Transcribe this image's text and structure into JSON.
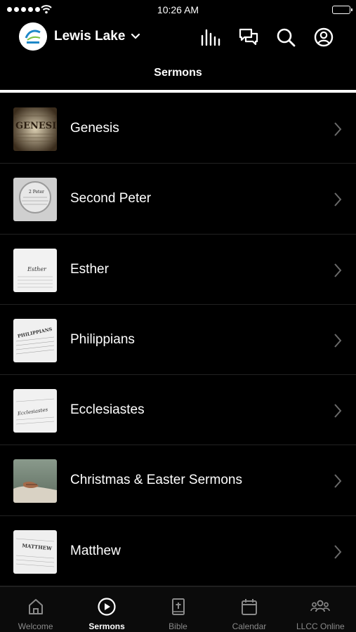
{
  "status_bar": {
    "time": "10:26 AM"
  },
  "header": {
    "org_name": "Lewis Lake",
    "logo_text": "Lewis Lake"
  },
  "tab": {
    "title": "Sermons"
  },
  "sermons": [
    {
      "title": "Genesis",
      "thumb": "GENESIS"
    },
    {
      "title": "Second Peter",
      "thumb": "2 Peter"
    },
    {
      "title": "Esther",
      "thumb": "Esther"
    },
    {
      "title": "Philippians",
      "thumb": "PHILIPPIANS"
    },
    {
      "title": "Ecclesiastes",
      "thumb": "Ecclesiastes"
    },
    {
      "title": "Christmas & Easter Sermons",
      "thumb": ""
    },
    {
      "title": "Matthew",
      "thumb": "MATTHEW"
    }
  ],
  "tabbar": [
    {
      "label": "Welcome",
      "icon": "home-icon",
      "active": false
    },
    {
      "label": "Sermons",
      "icon": "play-circle-icon",
      "active": true
    },
    {
      "label": "Bible",
      "icon": "bible-icon",
      "active": false
    },
    {
      "label": "Calendar",
      "icon": "calendar-icon",
      "active": false
    },
    {
      "label": "LLCC Online",
      "icon": "people-icon",
      "active": false
    }
  ]
}
